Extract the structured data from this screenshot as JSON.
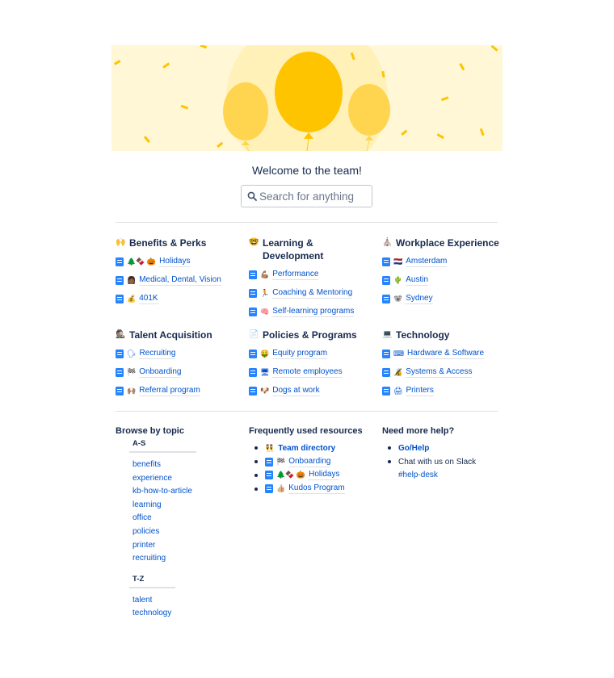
{
  "welcome": "Welcome to the team!",
  "search": {
    "placeholder": "Search for anything"
  },
  "sections": {
    "benefits": {
      "emoji": "🙌",
      "title": "Benefits & Perks",
      "links": [
        {
          "emoji": "🌲🍫 🎃",
          "label": "Holidays"
        },
        {
          "emoji": "👩🏾",
          "label": "Medical, Dental, Vision"
        },
        {
          "emoji": "💰",
          "label": "401K"
        }
      ]
    },
    "learning": {
      "emoji": "🤓",
      "title": "Learning & Development",
      "links": [
        {
          "emoji": "💪🏽",
          "label": "Performance"
        },
        {
          "emoji": "🏃",
          "label": "Coaching & Mentoring"
        },
        {
          "emoji": "🧠",
          "label": "Self-learning programs"
        }
      ]
    },
    "workplace": {
      "emoji": "⛪",
      "title": "Workplace Experience",
      "links": [
        {
          "emoji": "🇳🇱",
          "label": "Amsterdam"
        },
        {
          "emoji": "🌵",
          "label": "Austin"
        },
        {
          "emoji": "🐨",
          "label": "Sydney"
        }
      ]
    },
    "talent": {
      "emoji": "🕵🏽",
      "title": "Talent Acquisition",
      "links": [
        {
          "emoji": "🗣",
          "label": "Recruiting"
        },
        {
          "emoji": "🏁",
          "label": "Onboarding"
        },
        {
          "emoji": "🙌🏽",
          "label": "Referral program"
        }
      ]
    },
    "policies": {
      "emoji": "📄",
      "title": "Policies & Programs",
      "links": [
        {
          "emoji": "🤑",
          "label": "Equity program"
        },
        {
          "emoji": "🖥",
          "label": "Remote employees"
        },
        {
          "emoji": "🐶",
          "label": "Dogs at work"
        }
      ]
    },
    "technology": {
      "emoji": "💻",
      "title": "Technology",
      "links": [
        {
          "emoji": "⌨",
          "label": "Hardware & Software"
        },
        {
          "emoji": "🔏",
          "label": "Systems & Access"
        },
        {
          "emoji": "🖨",
          "label": "Printers"
        }
      ]
    }
  },
  "browse": {
    "title": "Browse by topic",
    "groups": [
      {
        "heading": "A-S",
        "topics": [
          "benefits",
          "experience",
          "kb-how-to-article",
          "learning",
          "office",
          "policies",
          "printer",
          "recruiting"
        ]
      },
      {
        "heading": "T-Z",
        "topics": [
          "talent",
          "technology"
        ]
      }
    ]
  },
  "resources": {
    "title": "Frequently used resources",
    "items": [
      {
        "emoji": "👯",
        "label": "Team directory",
        "page_icon": false,
        "bold": true
      },
      {
        "emoji": "🏁",
        "label": "Onboarding",
        "page_icon": true,
        "bold": false
      },
      {
        "emoji": "🌲🍫 🎃",
        "label": "Holidays",
        "page_icon": true,
        "bold": false
      },
      {
        "emoji": "👍🏼",
        "label": "Kudos Program",
        "page_icon": true,
        "bold": false
      }
    ]
  },
  "help": {
    "title": "Need more help?",
    "link": "Go/Help",
    "text": "Chat with us on Slack",
    "channel": "#help-desk"
  },
  "colors": {
    "link": "#0052cc",
    "text": "#172b4d",
    "page_icon": "#2684ff",
    "banner_bg": "#fff7d6",
    "balloon": "#ffc400"
  }
}
